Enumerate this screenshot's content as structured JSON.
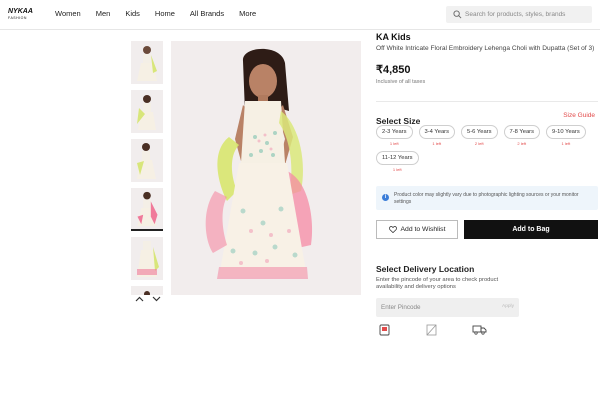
{
  "header": {
    "logo": {
      "line1": "NYKAA",
      "line2": "FASHION"
    },
    "nav": [
      "Women",
      "Men",
      "Kids",
      "Home",
      "All Brands",
      "More"
    ],
    "search": {
      "placeholder": "Search for products, styles, brands",
      "icon": "search-icon"
    }
  },
  "gallery": {
    "thumbnail_count": 6,
    "selected_thumbnail": 4,
    "arrows": {
      "up": "chevron-up-icon",
      "down": "chevron-down-icon"
    }
  },
  "product": {
    "brand": "KA Kids",
    "name": "Off White Intricate Floral Embroidery Lehenga Choli with Dupatta (Set of 3)",
    "price": "₹4,850",
    "tax_note": "Inclusive of all taxes"
  },
  "size": {
    "title": "Select Size",
    "guide_label": "Size Guide",
    "options": [
      {
        "label": "2-3 Years",
        "left": "1 left"
      },
      {
        "label": "3-4 Years",
        "left": "1 left"
      },
      {
        "label": "5-6 Years",
        "left": "2 left"
      },
      {
        "label": "7-8 Years",
        "left": "2 left"
      },
      {
        "label": "9-10 Years",
        "left": "1 left"
      },
      {
        "label": "11-12 Years",
        "left": "1 left"
      }
    ]
  },
  "notice": {
    "text": "Product color may slightly vary due to photographic lighting sources or your monitor settings",
    "icon": "info-icon"
  },
  "actions": {
    "wishlist_label": "Add to Wishlist",
    "bag_label": "Add to Bag",
    "wishlist_icon": "heart-icon"
  },
  "delivery": {
    "title": "Select Delivery Location",
    "description": "Enter the pincode of your area to check product availability and delivery options",
    "pincode_placeholder": "Enter Pincode",
    "apply_label": "Apply",
    "icons": [
      "cod-icon",
      "return-icon",
      "delivery-truck-icon"
    ]
  },
  "colors": {
    "accent": "#e24a4a",
    "button_dark": "#111111",
    "info_blue": "#3b7dd8"
  }
}
